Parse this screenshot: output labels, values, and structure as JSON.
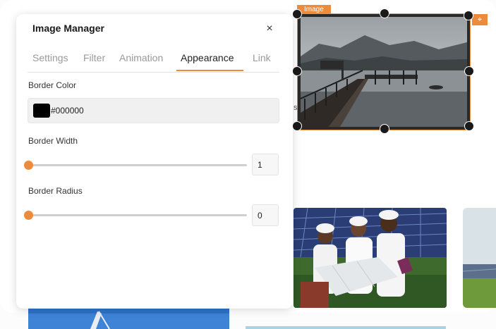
{
  "panel": {
    "title": "Image Manager",
    "close_symbol": "×",
    "tabs": [
      {
        "label": "Settings",
        "active": false
      },
      {
        "label": "Filter",
        "active": false
      },
      {
        "label": "Animation",
        "active": false
      },
      {
        "label": "Appearance",
        "active": true
      },
      {
        "label": "Link",
        "active": false
      }
    ],
    "border_color": {
      "label": "Border Color",
      "value": "#000000",
      "swatch": "#000000"
    },
    "border_width": {
      "label": "Border Width",
      "value": "1",
      "slider_fraction": 0
    },
    "border_radius": {
      "label": "Border Radius",
      "value": "0",
      "slider_fraction": 0
    }
  },
  "selection": {
    "tag_label": "Image",
    "settings_icon": "crosshair-icon"
  },
  "canvas": {
    "stray_text": "s"
  },
  "colors": {
    "accent": "#ec8b3c",
    "handle": "#1a1a1a"
  }
}
